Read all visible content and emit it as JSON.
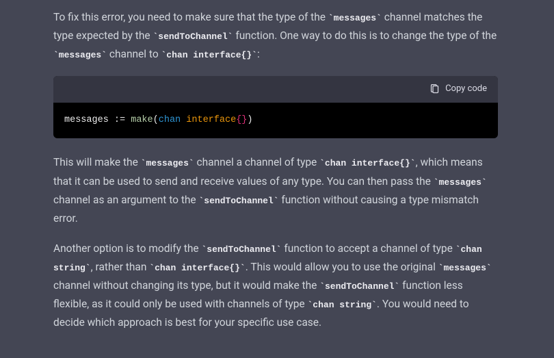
{
  "para1": {
    "s1": "To fix this error, you need to make sure that the type of the ",
    "c1": "`messages`",
    "s2": " channel matches the type expected by the ",
    "c2": "`sendToChannel`",
    "s3": " function. One way to do this is to change the type of the ",
    "c3": "`messages`",
    "s4": " channel to ",
    "c4": "`chan interface{}`",
    "s5": ":"
  },
  "codeblock": {
    "copy_label": "Copy code",
    "tokens": {
      "t1": "messages ",
      "t2": ":= ",
      "t3": "make",
      "t4": "(",
      "t5": "chan",
      "t6": " ",
      "t7": "interface",
      "t8": "{}",
      "t9": ")"
    }
  },
  "para2": {
    "s1": "This will make the ",
    "c1": "`messages`",
    "s2": " channel a channel of type ",
    "c2": "`chan interface{}`",
    "s3": ", which means that it can be used to send and receive values of any type. You can then pass the ",
    "c3": "`messages`",
    "s4": " channel as an argument to the ",
    "c4": "`sendToChannel`",
    "s5": " function without causing a type mismatch error."
  },
  "para3": {
    "s1": "Another option is to modify the ",
    "c1": "`sendToChannel`",
    "s2": " function to accept a channel of type ",
    "c2": "`chan string`",
    "s3": ", rather than ",
    "c3": "`chan interface{}`",
    "s4": ". This would allow you to use the original ",
    "c4": "`messages`",
    "s5": " channel without changing its type, but it would make the ",
    "c5": "`sendToChannel`",
    "s6": " function less flexible, as it could only be used with channels of type ",
    "c6": "`chan string`",
    "s7": ". You would need to decide which approach is best for your specific use case."
  }
}
